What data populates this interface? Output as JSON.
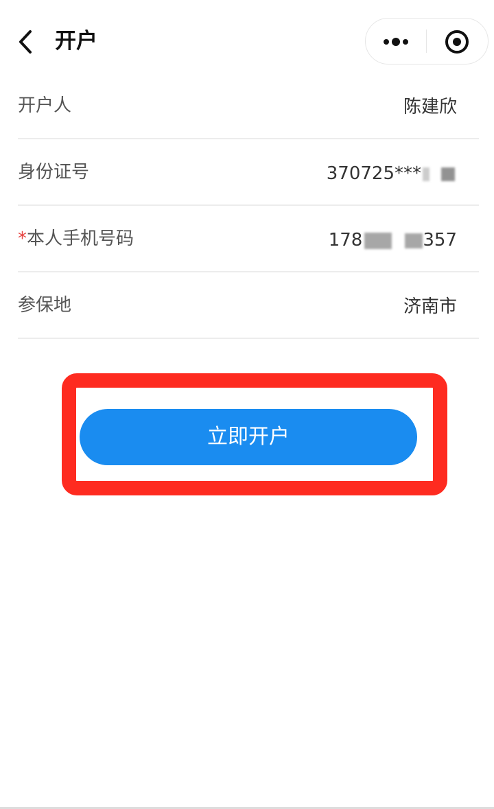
{
  "navbar": {
    "title": "开户",
    "back_icon": "chevron-left-icon",
    "more_icon": "more-dots-icon",
    "close_icon": "target-circle-icon"
  },
  "form": {
    "rows": [
      {
        "label": "开户人",
        "required": false,
        "value": "陈建欣"
      },
      {
        "label": "身份证号",
        "required": false,
        "value_prefix": "370725***",
        "value_suffix": ""
      },
      {
        "label": "本人手机号码",
        "required": true,
        "required_mark": "*",
        "value_prefix": "178",
        "value_suffix": "357"
      },
      {
        "label": "参保地",
        "required": false,
        "value": "济南市"
      }
    ]
  },
  "action": {
    "open_label": "立即开户",
    "button_color": "#1a8cf0",
    "highlight_color": "#fe2b20"
  }
}
